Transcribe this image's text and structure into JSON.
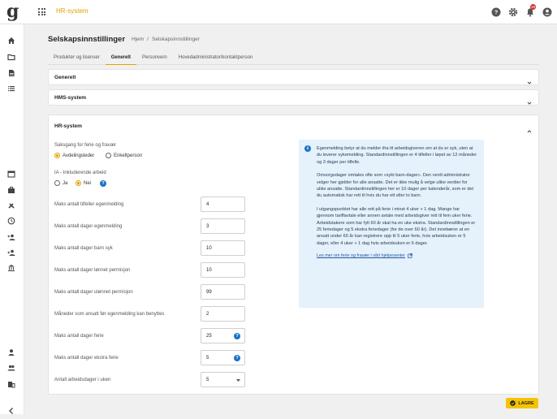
{
  "app": {
    "logo": "g",
    "title": "HR-system",
    "notification_count": "19"
  },
  "header": {
    "title": "Selskapsinnstillinger",
    "breadcrumb": [
      "Hjem",
      "/",
      "Selskapsinnstillinger"
    ]
  },
  "tabs": [
    {
      "label": "Produkter og lisenser",
      "active": false
    },
    {
      "label": "Generelt",
      "active": true
    },
    {
      "label": "Personvern",
      "active": false
    },
    {
      "label": "Hovedadministrator/kontaktperson",
      "active": false
    }
  ],
  "sections": {
    "general": {
      "title": "Generelt"
    },
    "hms": {
      "title": "HMS-system"
    },
    "hr": {
      "title": "HR-system"
    }
  },
  "hr": {
    "case_flow": {
      "label": "Saksgang for ferie og fravær",
      "options": [
        "Avdelingsleder",
        "Enkeltperson"
      ],
      "selected": "Avdelingsleder"
    },
    "ia": {
      "label": "IA - Inkluderende arbeid",
      "options": [
        "Ja",
        "Nei"
      ],
      "selected": "Nei"
    },
    "fields": [
      {
        "label": "Maks antall tilfeller egenmelding",
        "value": "4",
        "help": false
      },
      {
        "label": "Maks antall dager egenmelding",
        "value": "3",
        "help": false
      },
      {
        "label": "Maks antall dager barn syk",
        "value": "10",
        "help": false
      },
      {
        "label": "Maks antall dager lønnet permisjon",
        "value": "10",
        "help": false
      },
      {
        "label": "Maks antall dager ulønnet permisjon",
        "value": "99",
        "help": false
      },
      {
        "label": "Måneder som ansatt før egenmelding kan benyttes",
        "value": "2",
        "help": false
      },
      {
        "label": "Maks antall dager ferie",
        "value": "25",
        "help": true
      },
      {
        "label": "Maks antall dager ekstra ferie",
        "value": "5",
        "help": true
      },
      {
        "label": "Antall arbeidsdager i uken",
        "value": "5",
        "help": false,
        "select": true
      }
    ],
    "info": {
      "paragraphs": [
        "Egenmelding betyr at du melder ifra til arbeidsgiveren om at du er syk, uten at du leverer sykemelding. Standardinnstillingen er 4 tilfeller i løpet av 12 måneder og 3 dager per tilfelle.",
        "Omsorgsdager omtales ofte som «sykt barn-dager». Den verdi administrator velger her gjelder for alle ansatte. Det er ikke mulig å velge ulike verdier for ulike ansatte. Standardinnstillingen her er 10 dager per kalenderår, som er det du automatisk har rett til hvis du har ett eller to barn.",
        "I utgangspunktet har alle rett på ferie i minst 4 uker + 1 dag. Mange har gjennom tariffavtale eller annen avtale med arbeidsgiver rett til fem uker ferie. Arbeidstakere som har fylt 60 år skal ha en uke ekstra. Standardinnstillingen er 25 feriedager og 5 ekstra feriedager (for de over 60 år). Det innebærer at en ansatt under 60 år kan registrere opp til 5 uker ferie, hvis arbeidsuken er 5 dager, eller 4 uker + 1 dag hvis arbeidsuken er 6 dager."
      ],
      "link": "Les mer om ferie og fravær i vårt hjelpesenter"
    }
  },
  "save_label": "LAGRE",
  "colors": {
    "accent": "#e0a300",
    "save": "#f5c400",
    "info_bg": "#e5f1fb",
    "help": "#1a73c9"
  }
}
